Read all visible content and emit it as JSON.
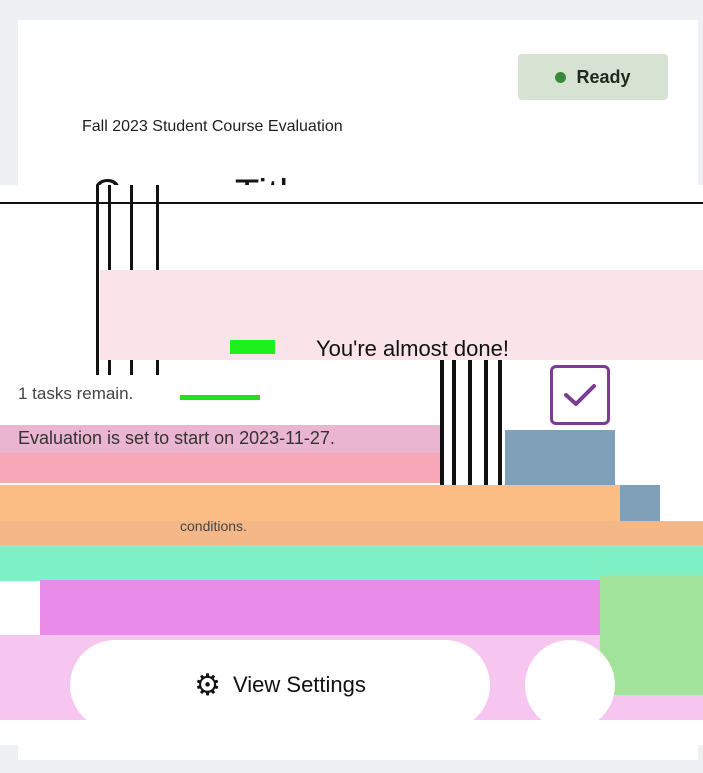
{
  "status": {
    "label": "Ready",
    "color": "#3a8a3a"
  },
  "evaluation": {
    "title": "Fall 2023 Student Course Evaluation"
  },
  "course": {
    "title": "Course Title"
  },
  "progress": {
    "heading": "You're almost done!",
    "tasks_remaining": "1 tasks remain.",
    "start_message": "Evaluation is set to start on 2023-11-27."
  },
  "conditions": {
    "text": "conditions."
  },
  "actions": {
    "settings_label": "View Settings",
    "checkbox_icon": "check-icon",
    "gear_icon": "gear-icon"
  }
}
